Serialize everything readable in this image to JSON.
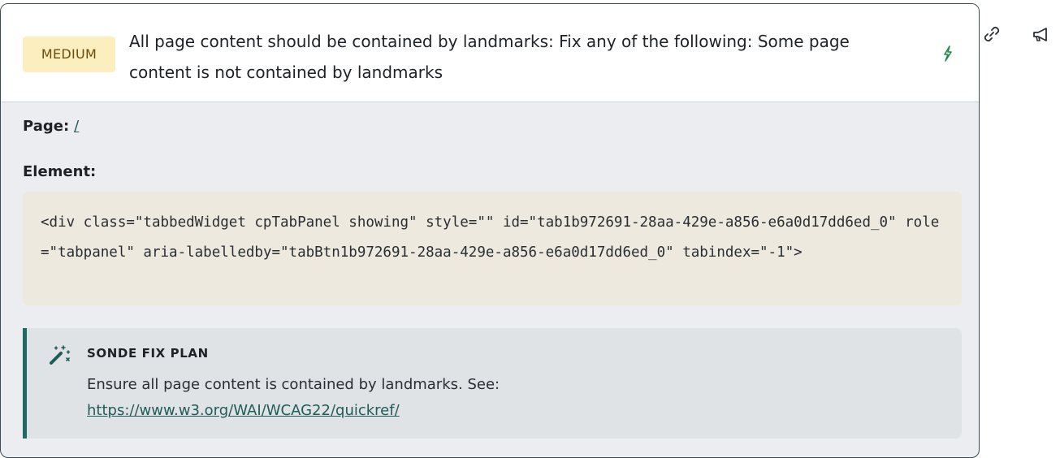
{
  "issue": {
    "severity": "MEDIUM",
    "title": "All page content should be contained by landmarks: Fix any of the following: Some page content is not contained by landmarks",
    "icons": {
      "auto_fix": "lightning-icon",
      "copy_link": "link-icon",
      "report": "megaphone-icon"
    }
  },
  "details": {
    "page_label": "Page:",
    "page_value": "/",
    "element_label": "Element:",
    "element_code": "<div class=\"tabbedWidget cpTabPanel showing\" style=\"\" id=\"tab1b972691-28aa-429e-a856-e6a0d17dd6ed_0\" role=\"tabpanel\" aria-labelledby=\"tabBtn1b972691-28aa-429e-a856-e6a0d17dd6ed_0\" tabindex=\"-1\">"
  },
  "fix_plan": {
    "icon": "magic-wand-icon",
    "title": "SONDE FIX PLAN",
    "text": "Ensure all page content is contained by landmarks. See:",
    "link": "https://www.w3.org/WAI/WCAG22/quickref/"
  },
  "colors": {
    "badge_bg": "#fbefc0",
    "badge_text": "#6b4e0b",
    "accent": "#1f6b63",
    "code_bg": "#ede9df",
    "panel_bg": "#ebedf0"
  }
}
